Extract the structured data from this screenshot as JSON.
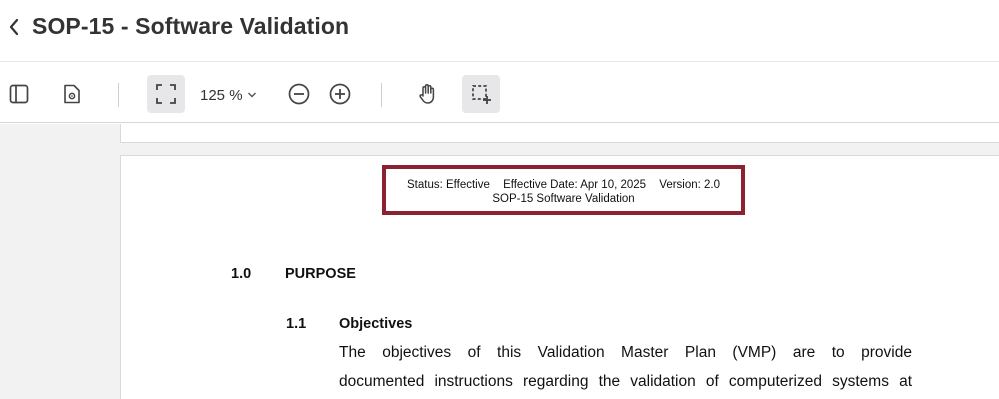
{
  "header": {
    "title": "SOP-15 - Software Validation"
  },
  "toolbar": {
    "zoom_label": "125 %",
    "buttons": [
      {
        "name": "sidebar-toggle",
        "icon": "sidebar-icon"
      },
      {
        "name": "document-properties",
        "icon": "document-settings-icon"
      },
      {
        "name": "fit-page",
        "icon": "fit-page-icon",
        "active": true
      },
      {
        "name": "zoom-out",
        "icon": "zoom-out-icon"
      },
      {
        "name": "zoom-in",
        "icon": "zoom-in-icon"
      },
      {
        "name": "pan-tool",
        "icon": "hand-icon"
      },
      {
        "name": "area-select",
        "icon": "select-area-icon",
        "active": true
      }
    ]
  },
  "document": {
    "header_box": {
      "status": "Status: Effective",
      "effective_date": "Effective Date: Apr 10, 2025",
      "version": "Version: 2.0",
      "doc_name": "SOP-15 Software Validation"
    },
    "section": {
      "number": "1.0",
      "title": "PURPOSE"
    },
    "subsection": {
      "number": "1.1",
      "title": "Objectives"
    },
    "body_lines": [
      "The objectives of this Validation Master Plan (VMP) are to provide",
      "documented instructions regarding the validation of computerized systems at"
    ]
  },
  "colors": {
    "highlight_border": "#8c2231",
    "active_button_bg": "#e7e7e9",
    "viewer_bg": "#f2f2f3"
  }
}
